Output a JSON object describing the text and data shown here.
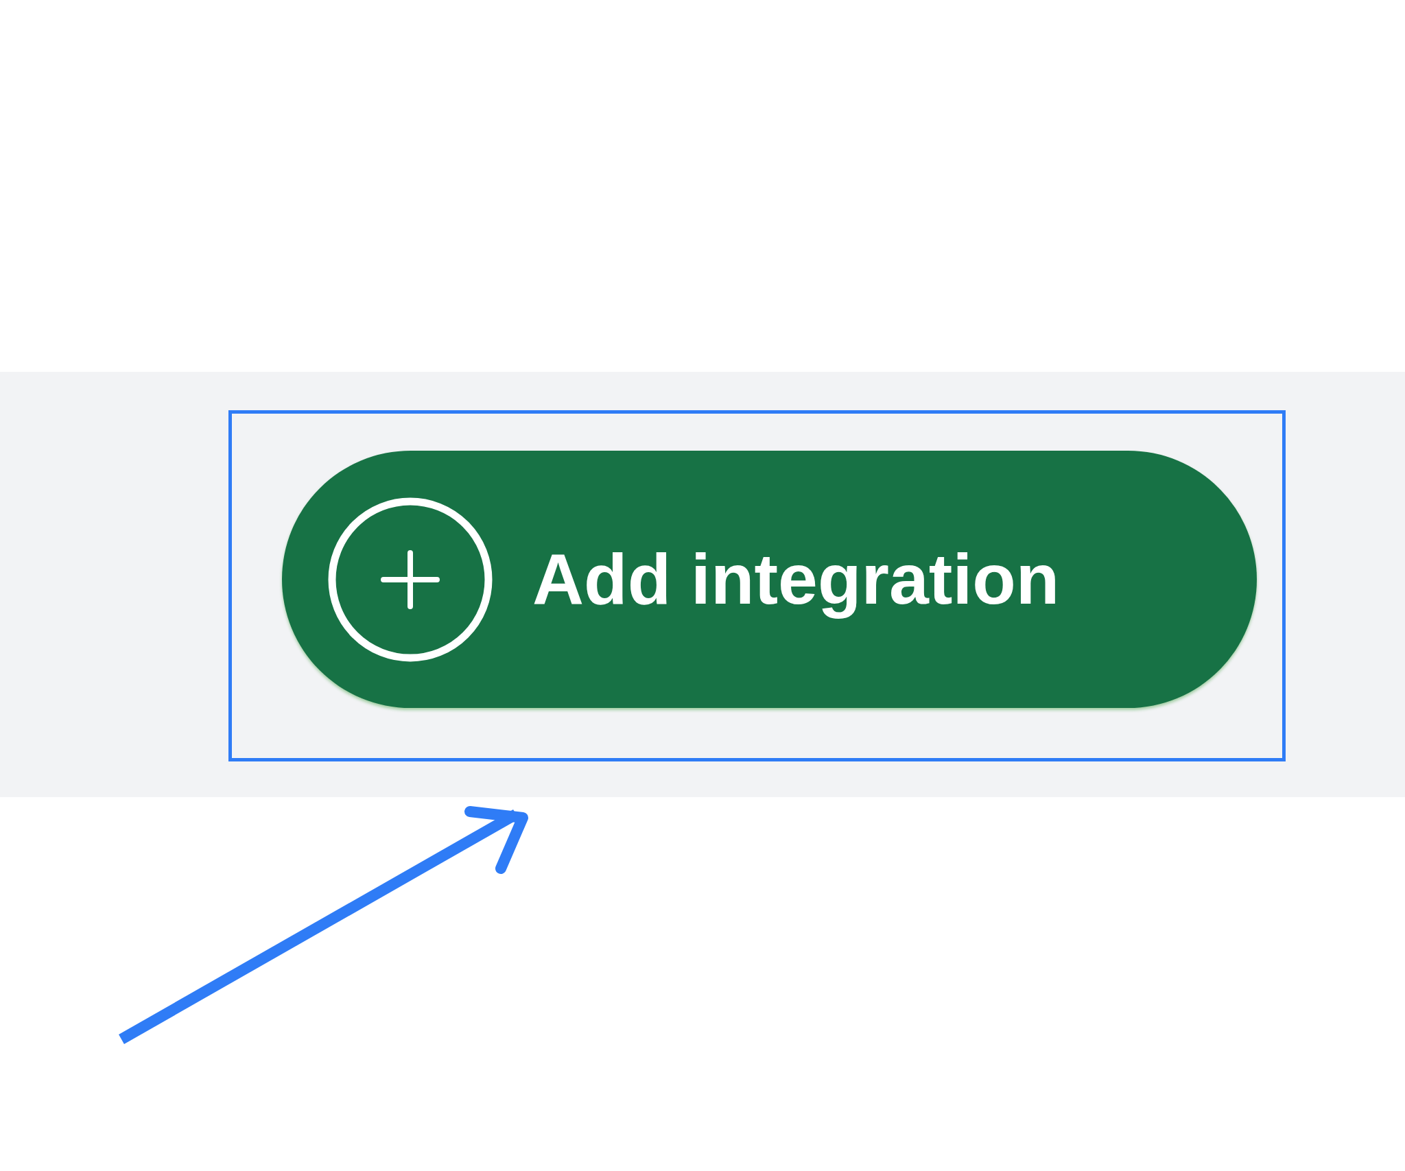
{
  "button": {
    "label": "Add integration"
  }
}
